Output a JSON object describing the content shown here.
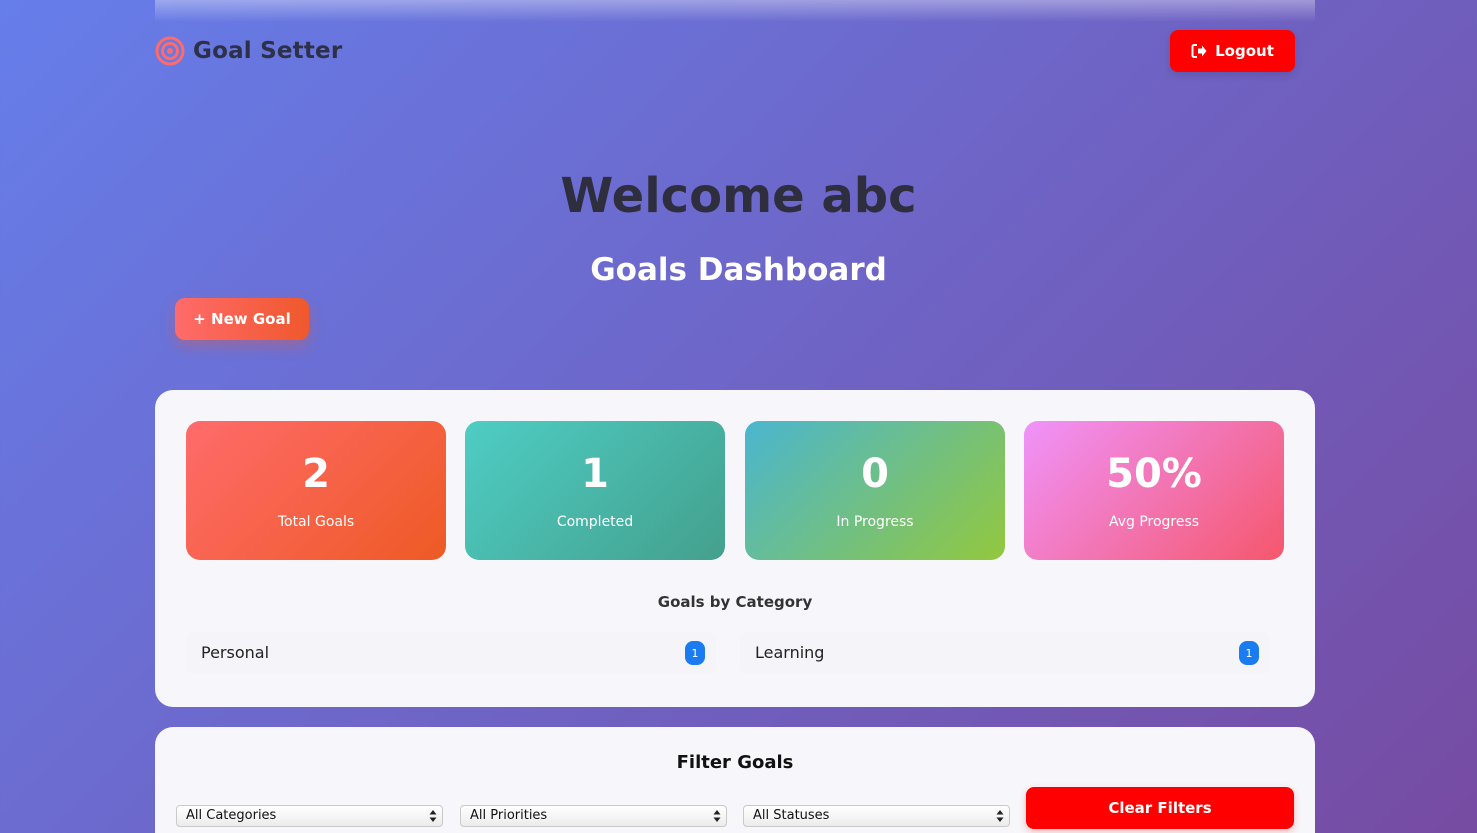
{
  "header": {
    "brand_name": "Goal Setter",
    "logout_label": "Logout"
  },
  "welcome_text": "Welcome abc",
  "dashboard_title": "Goals Dashboard",
  "new_goal_label": "+ New Goal",
  "stats": [
    {
      "value": "2",
      "label": "Total Goals"
    },
    {
      "value": "1",
      "label": "Completed"
    },
    {
      "value": "0",
      "label": "In Progress"
    },
    {
      "value": "50%",
      "label": "Avg Progress"
    }
  ],
  "categories": {
    "title": "Goals by Category",
    "items": [
      {
        "name": "Personal",
        "count": "1"
      },
      {
        "name": "Learning",
        "count": "1"
      }
    ]
  },
  "filters": {
    "title": "Filter Goals",
    "category_selected": "All Categories",
    "priority_selected": "All Priorities",
    "status_selected": "All Statuses",
    "clear_label": "Clear Filters"
  },
  "colors": {
    "accent_red": "#ff0000",
    "badge_blue": "#1a7cf0",
    "brand_icon": "#ff6b6b"
  },
  "icons": {
    "brand": "target-icon",
    "logout": "sign-out-icon",
    "select_arrows": "updown-arrows-icon"
  }
}
